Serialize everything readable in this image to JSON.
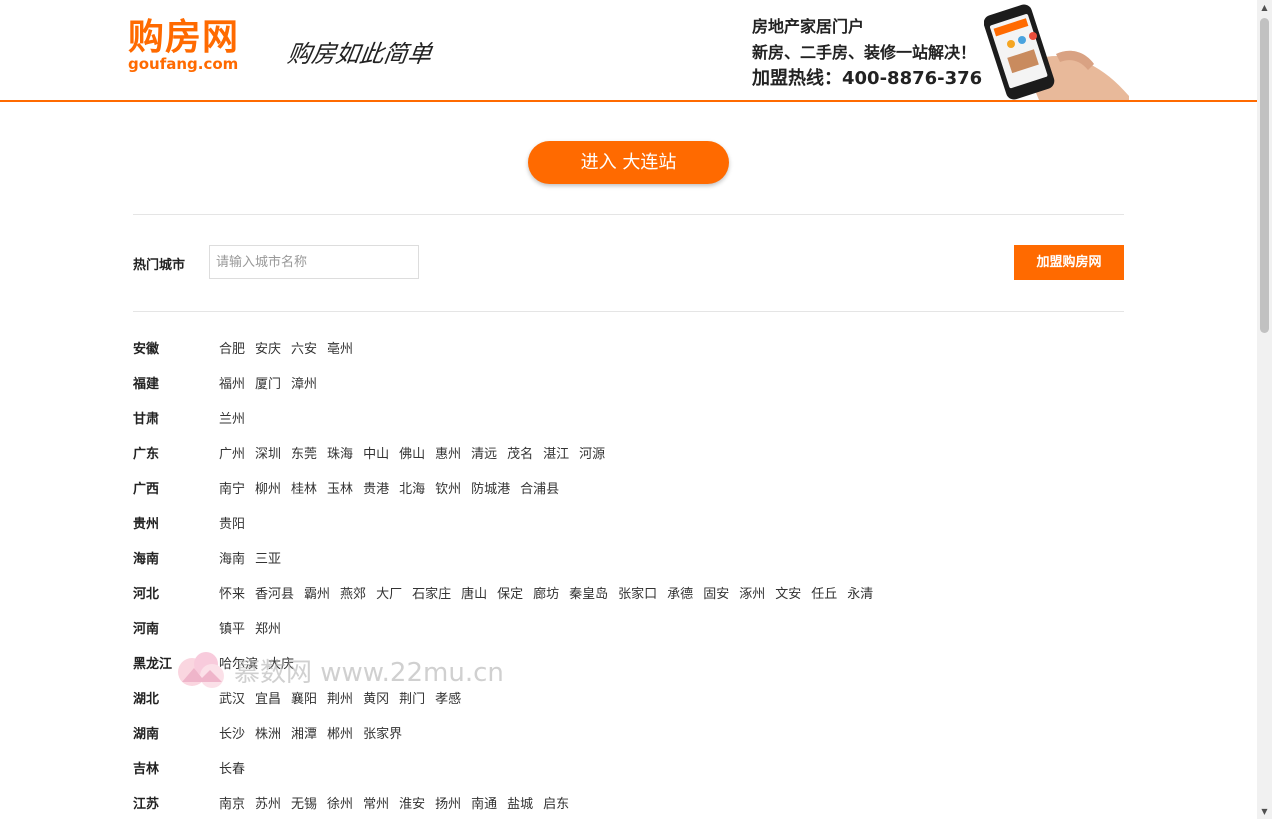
{
  "header": {
    "logo_cn": "购房网",
    "logo_en": "goufang.com",
    "slogan": "购房如此简单",
    "promo_line1": "房地产家居门户",
    "promo_line2": "新房、二手房、装修一站解决！",
    "promo_line3": "加盟热线：400-8876-376"
  },
  "enter_button": "进入 大连站",
  "search": {
    "hot_label": "热门城市",
    "placeholder": "请输入城市名称",
    "value": ""
  },
  "join_button": "加盟购房网",
  "provinces": [
    {
      "name": "安徽",
      "cities": [
        "合肥",
        "安庆",
        "六安",
        "亳州"
      ]
    },
    {
      "name": "福建",
      "cities": [
        "福州",
        "厦门",
        "漳州"
      ]
    },
    {
      "name": "甘肃",
      "cities": [
        "兰州"
      ]
    },
    {
      "name": "广东",
      "cities": [
        "广州",
        "深圳",
        "东莞",
        "珠海",
        "中山",
        "佛山",
        "惠州",
        "清远",
        "茂名",
        "湛江",
        "河源"
      ]
    },
    {
      "name": "广西",
      "cities": [
        "南宁",
        "柳州",
        "桂林",
        "玉林",
        "贵港",
        "北海",
        "钦州",
        "防城港",
        "合浦县"
      ]
    },
    {
      "name": "贵州",
      "cities": [
        "贵阳"
      ]
    },
    {
      "name": "海南",
      "cities": [
        "海南",
        "三亚"
      ]
    },
    {
      "name": "河北",
      "cities": [
        "怀来",
        "香河县",
        "霸州",
        "燕郊",
        "大厂",
        "石家庄",
        "唐山",
        "保定",
        "廊坊",
        "秦皇岛",
        "张家口",
        "承德",
        "固安",
        "涿州",
        "文安",
        "任丘",
        "永清"
      ]
    },
    {
      "name": "河南",
      "cities": [
        "镇平",
        "郑州"
      ]
    },
    {
      "name": "黑龙江",
      "cities": [
        "哈尔滨",
        "大庆"
      ]
    },
    {
      "name": "湖北",
      "cities": [
        "武汉",
        "宜昌",
        "襄阳",
        "荆州",
        "黄冈",
        "荆门",
        "孝感"
      ]
    },
    {
      "name": "湖南",
      "cities": [
        "长沙",
        "株洲",
        "湘潭",
        "郴州",
        "张家界"
      ]
    },
    {
      "name": "吉林",
      "cities": [
        "长春"
      ]
    },
    {
      "name": "江苏",
      "cities": [
        "南京",
        "苏州",
        "无锡",
        "徐州",
        "常州",
        "淮安",
        "扬州",
        "南通",
        "盐城",
        "启东"
      ]
    }
  ],
  "watermark": "慕数网 www.22mu.cn",
  "colors": {
    "accent": "#ff6a00",
    "text": "#333333",
    "divider": "#e5e5e5"
  }
}
